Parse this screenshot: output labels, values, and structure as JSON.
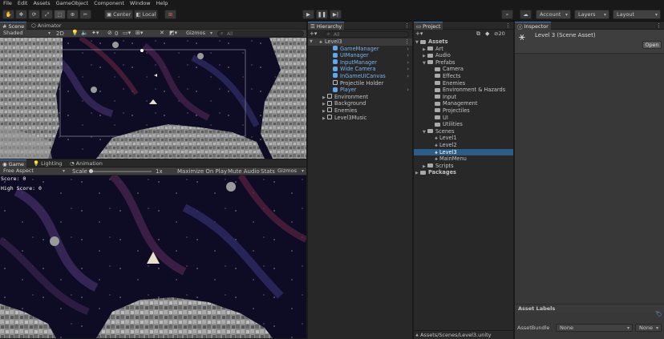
{
  "menu": [
    "File",
    "Edit",
    "Assets",
    "GameObject",
    "Component",
    "Window",
    "Help"
  ],
  "toolbar": {
    "pivot": "Center",
    "space": "Local",
    "account": "Account",
    "layers": "Layers",
    "layout": "Layout"
  },
  "scene": {
    "tabs": [
      "Scene",
      "Animator"
    ],
    "shading": "Shaded",
    "mode_2d": "2D",
    "gizmos": "Gizmos",
    "search_placeholder": "All",
    "layer_count": "0"
  },
  "game": {
    "tabs": [
      "Game",
      "Lighting",
      "Animation"
    ],
    "aspect": "Free Aspect",
    "scale_label": "Scale",
    "scale_value": "1x",
    "maximize": "Maximize On Play",
    "mute": "Mute Audio",
    "stats": "Stats",
    "gizmos": "Gizmos",
    "score": "Score: 0",
    "high_score": "High Score: 0"
  },
  "hierarchy": {
    "title": "Hierarchy",
    "search_placeholder": "All",
    "scene": "Level3",
    "items": [
      {
        "label": "GameManager",
        "type": "prefab"
      },
      {
        "label": "UIManager",
        "type": "prefab"
      },
      {
        "label": "InputManager",
        "type": "prefab"
      },
      {
        "label": "Wide Camera",
        "type": "prefab"
      },
      {
        "label": "InGameUICanvas",
        "type": "prefab"
      },
      {
        "label": "Projectile Holder",
        "type": "object"
      },
      {
        "label": "Player",
        "type": "prefab"
      },
      {
        "label": "Environment",
        "type": "object"
      },
      {
        "label": "Background",
        "type": "object"
      },
      {
        "label": "Enemies",
        "type": "object"
      },
      {
        "label": "Level3Music",
        "type": "object"
      }
    ]
  },
  "project": {
    "title": "Project",
    "badge": "20",
    "status_path": "Assets/Scenes/Level3.unity",
    "tree": [
      {
        "label": "Assets",
        "depth": 0,
        "bold": true
      },
      {
        "label": "Art",
        "depth": 1
      },
      {
        "label": "Audio",
        "depth": 1
      },
      {
        "label": "Prefabs",
        "depth": 1
      },
      {
        "label": "Camera",
        "depth": 2
      },
      {
        "label": "Effects",
        "depth": 2
      },
      {
        "label": "Enemies",
        "depth": 2
      },
      {
        "label": "Environment & Hazards",
        "depth": 2
      },
      {
        "label": "Input",
        "depth": 2
      },
      {
        "label": "Management",
        "depth": 2
      },
      {
        "label": "Projectiles",
        "depth": 2
      },
      {
        "label": "UI",
        "depth": 2
      },
      {
        "label": "Utilities",
        "depth": 2
      },
      {
        "label": "Scenes",
        "depth": 1
      },
      {
        "label": "Level1",
        "depth": 2,
        "scene": true
      },
      {
        "label": "Level2",
        "depth": 2,
        "scene": true
      },
      {
        "label": "Level3",
        "depth": 2,
        "scene": true,
        "selected": true
      },
      {
        "label": "MainMenu",
        "depth": 2,
        "scene": true
      },
      {
        "label": "Scripts",
        "depth": 1
      },
      {
        "label": "Packages",
        "depth": 0,
        "bold": true
      }
    ]
  },
  "inspector": {
    "title": "Inspector",
    "asset_name": "Level 3 (Scene Asset)",
    "open_label": "Open",
    "asset_labels": "Asset Labels",
    "assetbundle_label": "AssetBundle",
    "bundle_value": "None",
    "variant_value": "None"
  }
}
